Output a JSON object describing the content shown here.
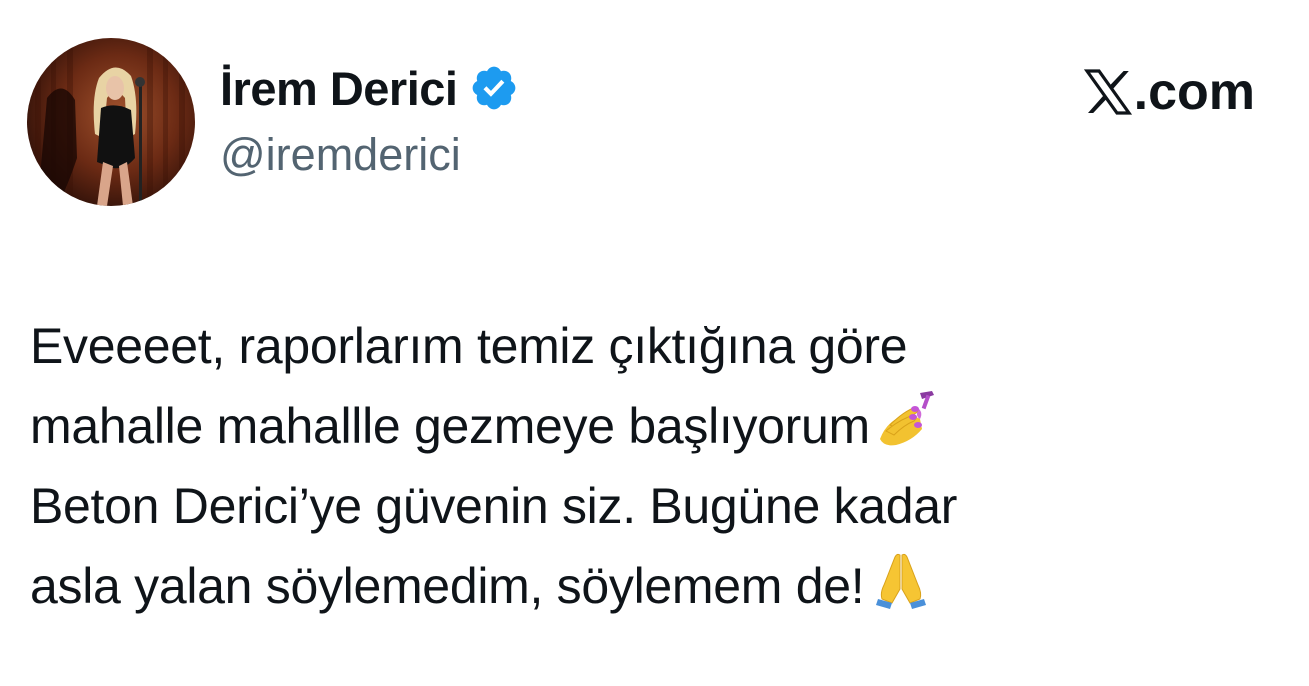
{
  "author": {
    "display_name": "İrem Derici",
    "handle": "@iremderici",
    "verified": true,
    "verified_color": "#1d9bf0",
    "avatar_icon": "profile-photo"
  },
  "brand": {
    "suffix": ".com",
    "icon": "x-logo-icon"
  },
  "tweet": {
    "lines": [
      "Eveeeet, raporlarım temiz çıktığına göre",
      "mahalle mahallle gezmeye başlıyorum",
      "Beton Derici’ye güvenin siz. Bugüne kadar",
      "asla yalan söylemedim, söylemem de!"
    ],
    "emojis": [
      "nail-polish-emoji",
      "folded-hands-emoji"
    ]
  },
  "colors": {
    "text_primary": "#0f1419",
    "text_secondary": "#536471",
    "background": "#ffffff"
  }
}
